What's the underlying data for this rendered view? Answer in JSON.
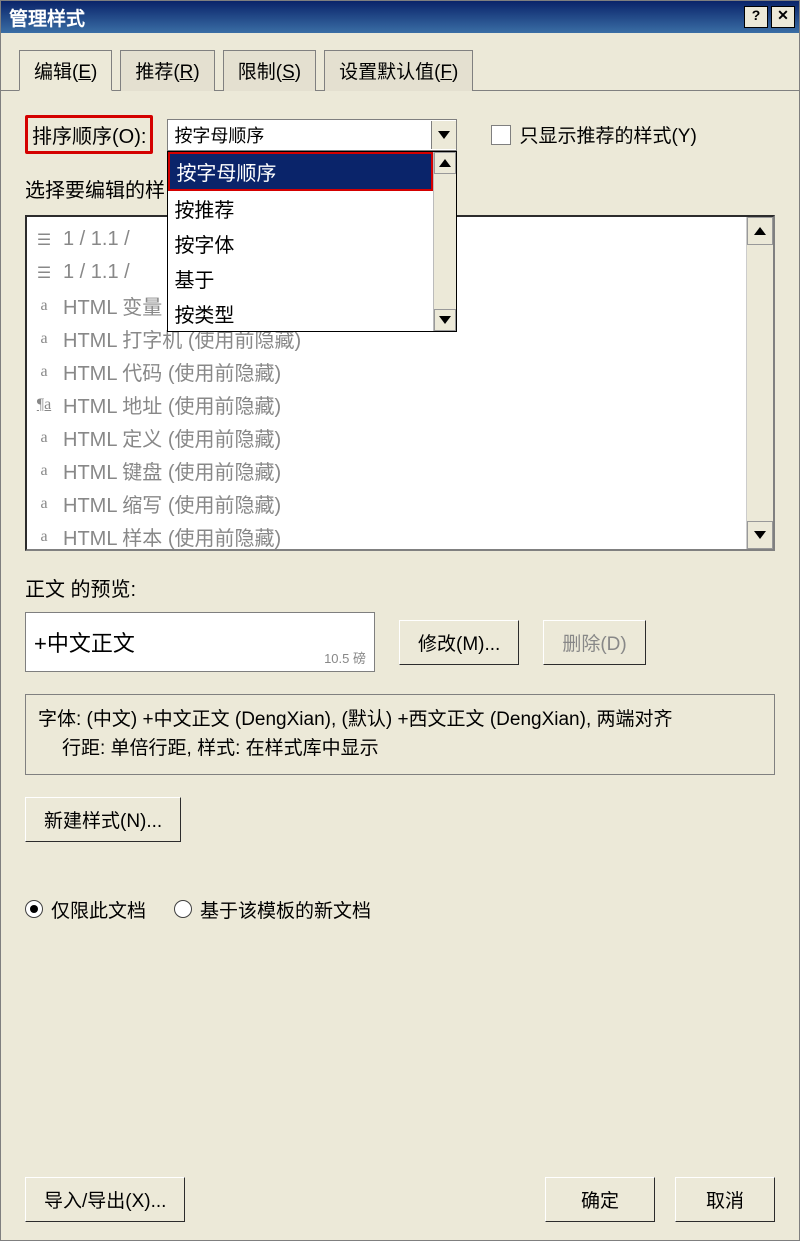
{
  "title": "管理样式",
  "tabs": [
    {
      "label": "编辑(E)",
      "key": "E"
    },
    {
      "label": "推荐(R)",
      "key": "R"
    },
    {
      "label": "限制(S)",
      "key": "S"
    },
    {
      "label": "设置默认值(F)",
      "key": "F"
    }
  ],
  "sort_label": "排序顺序(O):",
  "sort_value": "按字母顺序",
  "sort_options": [
    "按字母顺序",
    "按推荐",
    "按字体",
    "基于",
    "按类型"
  ],
  "recommended_only_label": "只显示推荐的样式(Y)",
  "select_label": "选择要编辑的样",
  "styles": [
    {
      "icon": "list",
      "text": "1 / 1.1 /"
    },
    {
      "icon": "list",
      "text": "1 / 1.1 /"
    },
    {
      "icon": "a",
      "text": "HTML 变量   (使用前隐藏)"
    },
    {
      "icon": "a",
      "text": "HTML 打字机  (使用前隐藏)"
    },
    {
      "icon": "a",
      "text": "HTML 代码   (使用前隐藏)"
    },
    {
      "icon": "pa",
      "text": "HTML 地址   (使用前隐藏)"
    },
    {
      "icon": "a",
      "text": "HTML 定义   (使用前隐藏)"
    },
    {
      "icon": "a",
      "text": "HTML 键盘   (使用前隐藏)"
    },
    {
      "icon": "a",
      "text": "HTML 缩写   (使用前隐藏)"
    },
    {
      "icon": "a",
      "text": "HTML 样本   (使用前隐藏)"
    }
  ],
  "preview_label": "正文 的预览:",
  "preview_text": "+中文正文",
  "preview_fontsize": "10.5 磅",
  "modify_btn": "修改(M)...",
  "delete_btn": "删除(D)",
  "desc_line1": "字体: (中文) +中文正文 (DengXian), (默认) +西文正文 (DengXian), 两端对齐",
  "desc_line2": "行距: 单倍行距, 样式: 在样式库中显示",
  "new_style_btn": "新建样式(N)...",
  "radio_this_doc": "仅限此文档",
  "radio_template": "基于该模板的新文档",
  "import_export_btn": "导入/导出(X)...",
  "ok_btn": "确定",
  "cancel_btn": "取消"
}
